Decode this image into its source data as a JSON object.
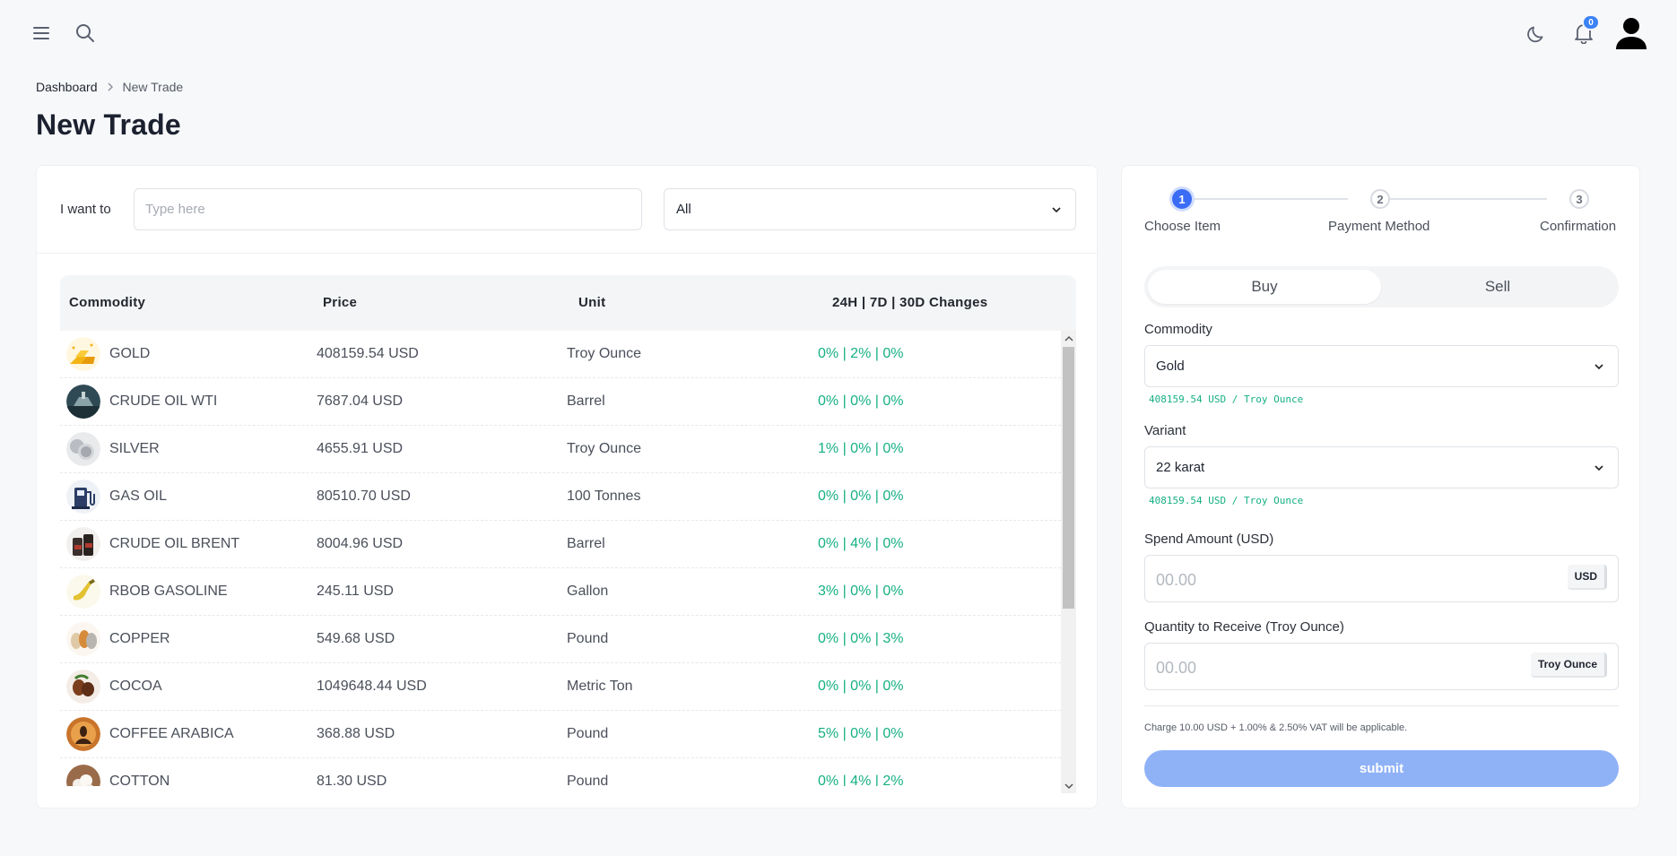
{
  "header": {
    "menu_icon": "hamburger-menu-icon",
    "search_icon": "search-icon",
    "theme_icon": "moon-icon",
    "notification_icon": "bell-icon",
    "notification_count": "0",
    "avatar_icon": "user-avatar-icon"
  },
  "breadcrumb": {
    "home": "Dashboard",
    "current": "New Trade"
  },
  "page": {
    "title": "New Trade"
  },
  "filter": {
    "label": "I want to",
    "search_placeholder": "Type here",
    "category_value": "All"
  },
  "table": {
    "columns": [
      "Commodity",
      "Price",
      "Unit",
      "24H | 7D | 30D Changes"
    ],
    "rows": [
      {
        "name": "GOLD",
        "price": "408159.54 USD",
        "unit": "Troy Ounce",
        "changes": "0% | 2% | 0%"
      },
      {
        "name": "CRUDE OIL WTI",
        "price": "7687.04 USD",
        "unit": "Barrel",
        "changes": "0% | 0% | 0%"
      },
      {
        "name": "SILVER",
        "price": "4655.91 USD",
        "unit": "Troy Ounce",
        "changes": "1% | 0% | 0%"
      },
      {
        "name": "GAS OIL",
        "price": "80510.70 USD",
        "unit": "100 Tonnes",
        "changes": "0% | 0% | 0%"
      },
      {
        "name": "CRUDE OIL BRENT",
        "price": "8004.96 USD",
        "unit": "Barrel",
        "changes": "0% | 4% | 0%"
      },
      {
        "name": "RBOB GASOLINE",
        "price": "245.11 USD",
        "unit": "Gallon",
        "changes": "3% | 0% | 0%"
      },
      {
        "name": "COPPER",
        "price": "549.68 USD",
        "unit": "Pound",
        "changes": "0% | 0% | 3%"
      },
      {
        "name": "COCOA",
        "price": "1049648.44 USD",
        "unit": "Metric Ton",
        "changes": "0% | 0% | 0%"
      },
      {
        "name": "COFFEE ARABICA",
        "price": "368.88 USD",
        "unit": "Pound",
        "changes": "5% | 0% | 0%"
      },
      {
        "name": "COTTON",
        "price": "81.30 USD",
        "unit": "Pound",
        "changes": "0% | 4% | 2%"
      }
    ]
  },
  "stepper": {
    "steps": [
      {
        "number": "1",
        "label": "Choose Item"
      },
      {
        "number": "2",
        "label": "Payment Method"
      },
      {
        "number": "3",
        "label": "Confirmation"
      }
    ]
  },
  "trade_form": {
    "buy_label": "Buy",
    "sell_label": "Sell",
    "commodity_label": "Commodity",
    "commodity_value": "Gold",
    "commodity_hint": "408159.54 USD / Troy Ounce",
    "variant_label": "Variant",
    "variant_value": "22 karat",
    "variant_hint": "408159.54 USD / Troy Ounce",
    "spend_label": "Spend Amount (USD)",
    "spend_placeholder": "00.00",
    "spend_unit": "USD",
    "qty_label": "Quantity to Receive (Troy Ounce)",
    "qty_placeholder": "00.00",
    "qty_unit": "Troy Ounce",
    "charge_note": "Charge 10.00 USD + 1.00% & 2.50% VAT will be applicable.",
    "submit_label": "submit"
  },
  "colors": {
    "accent": "#3b6cf6",
    "positive": "#16b083",
    "submit_disabled": "#8fb2f7"
  }
}
